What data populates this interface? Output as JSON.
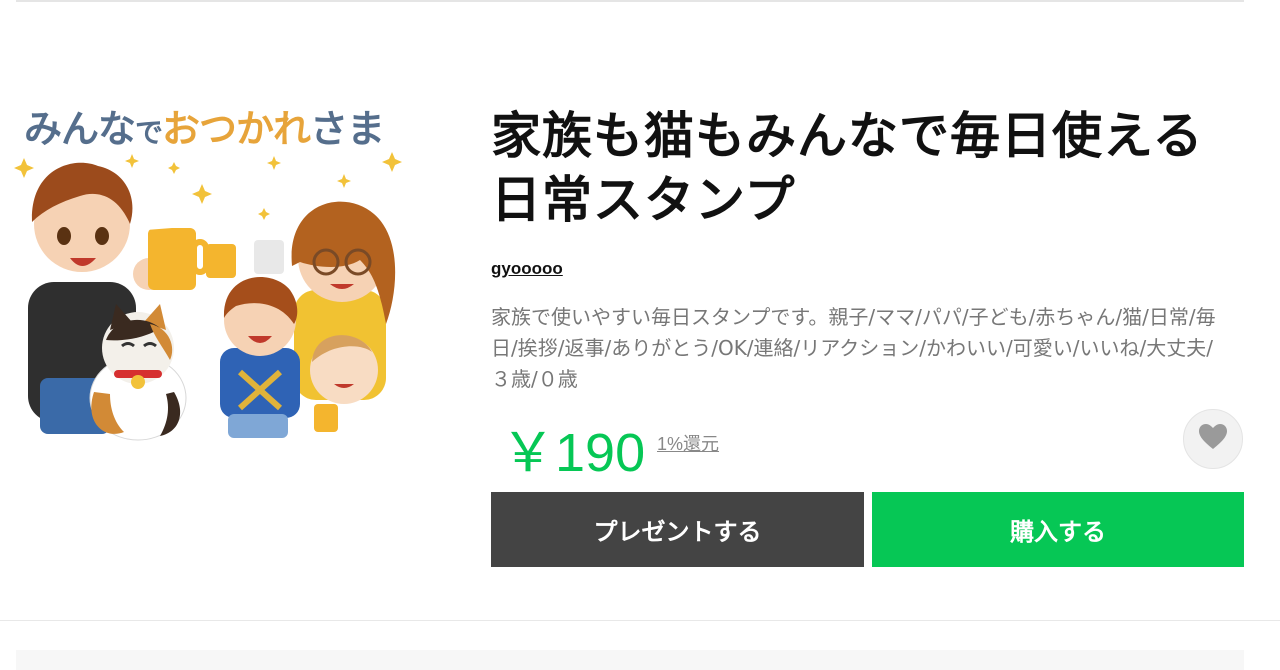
{
  "sticker": {
    "art_text_1": "みんな",
    "art_text_2": "で",
    "art_text_3": "おつかれ",
    "art_text_4": "さま"
  },
  "product": {
    "title": "家族も猫もみんなで毎日使える日常スタンプ",
    "author": "gyooooo",
    "description": "家族で使いやすい毎日スタンプです。親子/ママ/パパ/子ども/赤ちゃん/猫/日常/毎日/挨拶/返事/ありがとう/OK/連絡/リアクション/かわいい/可愛い/いいね/大丈夫/３歳/０歳",
    "price": "￥190",
    "cashback": "1%還元"
  },
  "actions": {
    "gift_label": "プレゼントする",
    "buy_label": "購入する"
  },
  "icons": {
    "favorite": "heart-icon"
  },
  "colors": {
    "accent": "#06c755",
    "gift_button": "#444444",
    "heart": "#9a9a9a"
  }
}
